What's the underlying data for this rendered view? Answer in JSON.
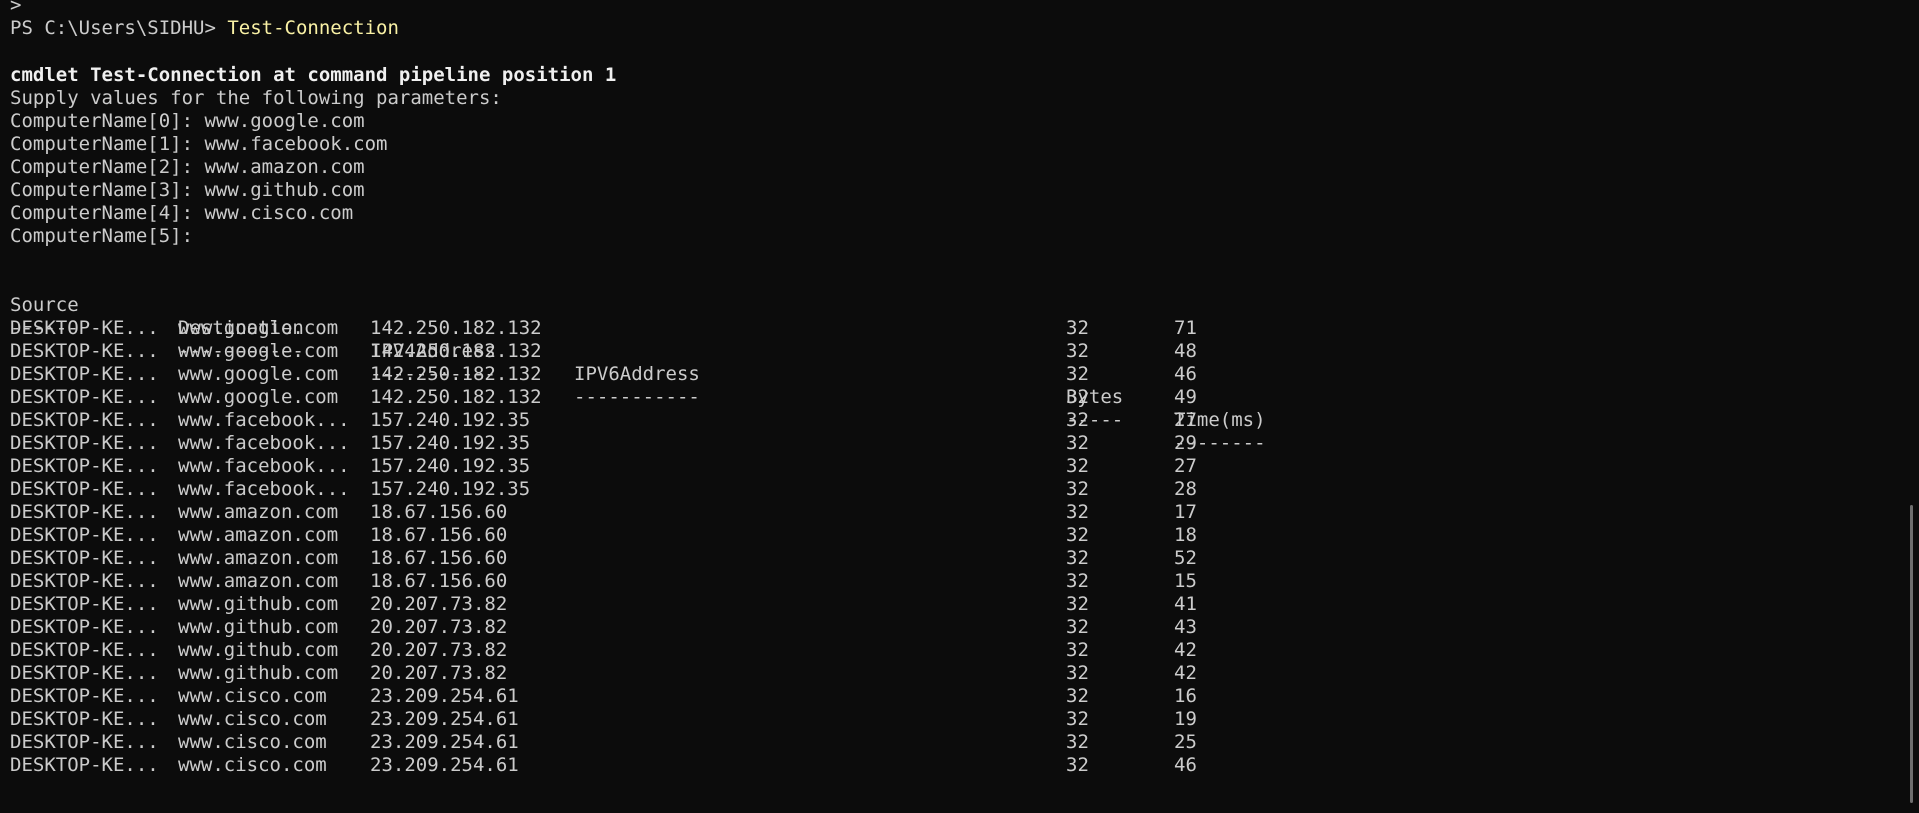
{
  "console": {
    "top_prompt_fragment": ">",
    "prompt": "PS C:\\Users\\SIDHU> ",
    "command": "Test-Connection",
    "cmdlet_message": "cmdlet Test-Connection at command pipeline position 1",
    "supply_message": "Supply values for the following parameters:",
    "parameters": [
      {
        "label": "ComputerName[0]: ",
        "value": "www.google.com"
      },
      {
        "label": "ComputerName[1]: ",
        "value": "www.facebook.com"
      },
      {
        "label": "ComputerName[2]: ",
        "value": "www.amazon.com"
      },
      {
        "label": "ComputerName[3]: ",
        "value": "www.github.com"
      },
      {
        "label": "ComputerName[4]: ",
        "value": "www.cisco.com"
      },
      {
        "label": "ComputerName[5]:",
        "value": ""
      }
    ]
  },
  "table": {
    "headers": [
      "Source",
      "Destination",
      "IPV4Address",
      "IPV6Address",
      "Bytes",
      "Time(ms)"
    ],
    "underlines": [
      "------",
      "-----------",
      "-----------",
      "-----------",
      "-----",
      "--------"
    ],
    "rows": [
      [
        "DESKTOP-KE...",
        "www.google.com",
        "142.250.182.132",
        "",
        "32",
        "71"
      ],
      [
        "DESKTOP-KE...",
        "www.google.com",
        "142.250.182.132",
        "",
        "32",
        "48"
      ],
      [
        "DESKTOP-KE...",
        "www.google.com",
        "142.250.182.132",
        "",
        "32",
        "46"
      ],
      [
        "DESKTOP-KE...",
        "www.google.com",
        "142.250.182.132",
        "",
        "32",
        "49"
      ],
      [
        "DESKTOP-KE...",
        "www.facebook...",
        "157.240.192.35",
        "",
        "32",
        "27"
      ],
      [
        "DESKTOP-KE...",
        "www.facebook...",
        "157.240.192.35",
        "",
        "32",
        "29"
      ],
      [
        "DESKTOP-KE...",
        "www.facebook...",
        "157.240.192.35",
        "",
        "32",
        "27"
      ],
      [
        "DESKTOP-KE...",
        "www.facebook...",
        "157.240.192.35",
        "",
        "32",
        "28"
      ],
      [
        "DESKTOP-KE...",
        "www.amazon.com",
        "18.67.156.60",
        "",
        "32",
        "17"
      ],
      [
        "DESKTOP-KE...",
        "www.amazon.com",
        "18.67.156.60",
        "",
        "32",
        "18"
      ],
      [
        "DESKTOP-KE...",
        "www.amazon.com",
        "18.67.156.60",
        "",
        "32",
        "52"
      ],
      [
        "DESKTOP-KE...",
        "www.amazon.com",
        "18.67.156.60",
        "",
        "32",
        "15"
      ],
      [
        "DESKTOP-KE...",
        "www.github.com",
        "20.207.73.82",
        "",
        "32",
        "41"
      ],
      [
        "DESKTOP-KE...",
        "www.github.com",
        "20.207.73.82",
        "",
        "32",
        "43"
      ],
      [
        "DESKTOP-KE...",
        "www.github.com",
        "20.207.73.82",
        "",
        "32",
        "42"
      ],
      [
        "DESKTOP-KE...",
        "www.github.com",
        "20.207.73.82",
        "",
        "32",
        "42"
      ],
      [
        "DESKTOP-KE...",
        "www.cisco.com",
        "23.209.254.61",
        "",
        "32",
        "16"
      ],
      [
        "DESKTOP-KE...",
        "www.cisco.com",
        "23.209.254.61",
        "",
        "32",
        "19"
      ],
      [
        "DESKTOP-KE...",
        "www.cisco.com",
        "23.209.254.61",
        "",
        "32",
        "25"
      ],
      [
        "DESKTOP-KE...",
        "www.cisco.com",
        "23.209.254.61",
        "",
        "32",
        "46"
      ]
    ]
  },
  "colors": {
    "background": "#0c0c0c",
    "text": "#cccccc",
    "command": "#f9f1a5"
  }
}
